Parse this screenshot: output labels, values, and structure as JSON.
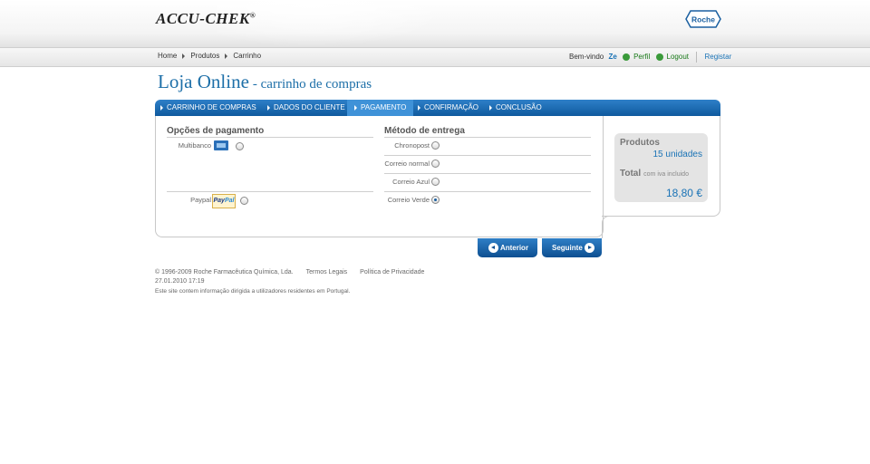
{
  "header": {
    "logo": "ACCU-CHEK",
    "logo_mark": "®",
    "brand_right": "Roche"
  },
  "breadcrumb": [
    "Home",
    "Produtos",
    "Carrinho"
  ],
  "user": {
    "welcome": "Bem-vindo",
    "name": "Ze",
    "profile": "Perfil",
    "logout": "Logout",
    "register": "Registar"
  },
  "page": {
    "title": "Loja Online",
    "subtitle": "- carrinho de compras"
  },
  "steps": [
    {
      "label": "CARRINHO DE COMPRAS",
      "active": false
    },
    {
      "label": "DADOS DO CLIENTE",
      "active": false
    },
    {
      "label": "PAGAMENTO",
      "active": true
    },
    {
      "label": "CONFIRMAÇÃO",
      "active": false
    },
    {
      "label": "CONCLUSÃO",
      "active": false
    }
  ],
  "payment": {
    "heading": "Opções de pagamento",
    "options": [
      {
        "label": "Multibanco",
        "icon": "multibanco-icon",
        "selected": false
      },
      {
        "label": "Paypal",
        "icon": "paypal-icon",
        "selected": false
      }
    ],
    "paypal_logo_a": "Pay",
    "paypal_logo_b": "Pal"
  },
  "delivery": {
    "heading": "Método de entrega",
    "options": [
      {
        "label": "Chronopost",
        "selected": false
      },
      {
        "label": "Correio normal",
        "selected": false
      },
      {
        "label": "Correio Azul",
        "selected": false
      },
      {
        "label": "Correio Verde",
        "selected": true
      }
    ]
  },
  "summary": {
    "products_label": "Produtos",
    "units": "15 unidades",
    "total_label": "Total",
    "total_note": "com iva incluido",
    "total_value": "18,80 €"
  },
  "buttons": {
    "previous": "Anterior",
    "next": "Seguinte"
  },
  "footer": {
    "copyright": "© 1996-2009 Roche Farmacêutica Química, Lda.",
    "terms": "Termos Legais",
    "privacy": "Política de Privacidade",
    "date": "27.01.2010 17:19",
    "note": "Este site contem informação dirigida a utilizadores residentes em Portugal."
  },
  "colors": {
    "accent_blue": "#1a73b6",
    "step_bar": "#0f5a9e",
    "step_active": "#3f92d8",
    "summary_bg": "#e4e4e4"
  }
}
